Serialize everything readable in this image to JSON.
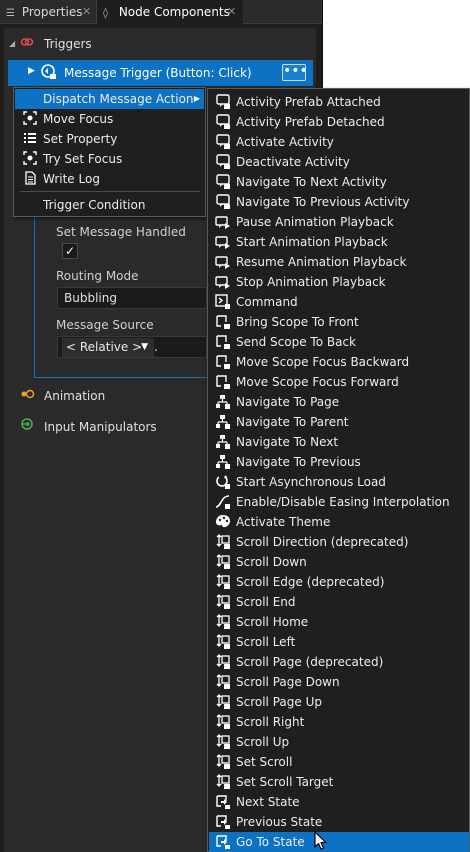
{
  "tabs": [
    {
      "label": "Properties",
      "icon": "list-icon",
      "active": false
    },
    {
      "label": "Node Components",
      "icon": "node-components-icon",
      "active": true
    }
  ],
  "tab_close_glyph": "✕",
  "sections": {
    "triggers": "Triggers",
    "animation": "Animation",
    "input_manipulators": "Input Manipulators"
  },
  "trigger": {
    "label": "Message Trigger (Button: Click)",
    "more_glyph": "•••"
  },
  "properties": {
    "set_message_handled_label": "Set Message Handled",
    "set_message_handled_checked": true,
    "routing_mode_label": "Routing Mode",
    "routing_mode_value": "Bubbling",
    "message_source_label": "Message Source",
    "message_source_value": "< Relative >",
    "message_source_path": "."
  },
  "menu1": {
    "items": [
      {
        "label": "Dispatch Message Action",
        "icon": "",
        "highlighted": true,
        "has_submenu": true
      },
      {
        "label": "Move Focus",
        "icon": "focus-icon"
      },
      {
        "label": "Set Property",
        "icon": "property-list-icon"
      },
      {
        "label": "Try Set Focus",
        "icon": "focus-icon"
      },
      {
        "label": "Write Log",
        "icon": "log-document-icon"
      },
      {
        "label": "Trigger Condition",
        "icon": ""
      }
    ]
  },
  "menu2": {
    "items": [
      {
        "label": "Activity Prefab Attached",
        "icon": "message-bubble-icon"
      },
      {
        "label": "Activity Prefab Detached",
        "icon": "message-bubble-icon"
      },
      {
        "label": "Activate Activity",
        "icon": "message-bubble-icon"
      },
      {
        "label": "Deactivate Activity",
        "icon": "message-bubble-icon"
      },
      {
        "label": "Navigate To Next Activity",
        "icon": "message-bubble-icon"
      },
      {
        "label": "Navigate To Previous Activity",
        "icon": "message-bubble-icon"
      },
      {
        "label": "Pause Animation Playback",
        "icon": "animation-message-icon"
      },
      {
        "label": "Start Animation Playback",
        "icon": "animation-message-icon"
      },
      {
        "label": "Resume Animation Playback",
        "icon": "animation-message-icon"
      },
      {
        "label": "Stop Animation Playback",
        "icon": "animation-message-icon"
      },
      {
        "label": "Command",
        "icon": "command-message-icon"
      },
      {
        "label": "Bring Scope To Front",
        "icon": "scope-message-icon"
      },
      {
        "label": "Send Scope To Back",
        "icon": "scope-message-icon"
      },
      {
        "label": "Move Scope Focus Backward",
        "icon": "scope-message-icon"
      },
      {
        "label": "Move Scope Focus Forward",
        "icon": "scope-message-icon"
      },
      {
        "label": "Navigate To Page",
        "icon": "navigation-tree-icon"
      },
      {
        "label": "Navigate To Parent",
        "icon": "navigation-tree-icon"
      },
      {
        "label": "Navigate To Next",
        "icon": "navigation-tree-icon"
      },
      {
        "label": "Navigate To Previous",
        "icon": "navigation-tree-icon"
      },
      {
        "label": "Start Asynchronous Load",
        "icon": "async-load-icon"
      },
      {
        "label": "Enable/Disable Easing Interpolation",
        "icon": "easing-icon"
      },
      {
        "label": "Activate Theme",
        "icon": "theme-palette-icon"
      },
      {
        "label": "Scroll Direction (deprecated)",
        "icon": "scroll-message-icon"
      },
      {
        "label": "Scroll Down",
        "icon": "scroll-message-icon"
      },
      {
        "label": "Scroll Edge (deprecated)",
        "icon": "scroll-message-icon"
      },
      {
        "label": "Scroll End",
        "icon": "scroll-message-icon"
      },
      {
        "label": "Scroll Home",
        "icon": "scroll-message-icon"
      },
      {
        "label": "Scroll Left",
        "icon": "scroll-message-icon"
      },
      {
        "label": "Scroll Page (deprecated)",
        "icon": "scroll-message-icon"
      },
      {
        "label": "Scroll Page Down",
        "icon": "scroll-message-icon"
      },
      {
        "label": "Scroll Page Up",
        "icon": "scroll-message-icon"
      },
      {
        "label": "Scroll Right",
        "icon": "scroll-message-icon"
      },
      {
        "label": "Scroll Up",
        "icon": "scroll-message-icon"
      },
      {
        "label": "Set Scroll",
        "icon": "scroll-message-icon"
      },
      {
        "label": "Set Scroll Target",
        "icon": "scroll-message-icon"
      },
      {
        "label": "Next State",
        "icon": "state-message-icon"
      },
      {
        "label": "Previous State",
        "icon": "state-message-icon"
      },
      {
        "label": "Go To State",
        "icon": "state-message-icon",
        "highlighted": true
      }
    ]
  },
  "colors": {
    "accent": "#0e72c4",
    "panel_bg": "#1e1e1e",
    "menu_bg": "#1f1f1f",
    "triggers_icon": "#e04848",
    "animation_icon": "#f0a030",
    "input_icon": "#4caf50"
  }
}
